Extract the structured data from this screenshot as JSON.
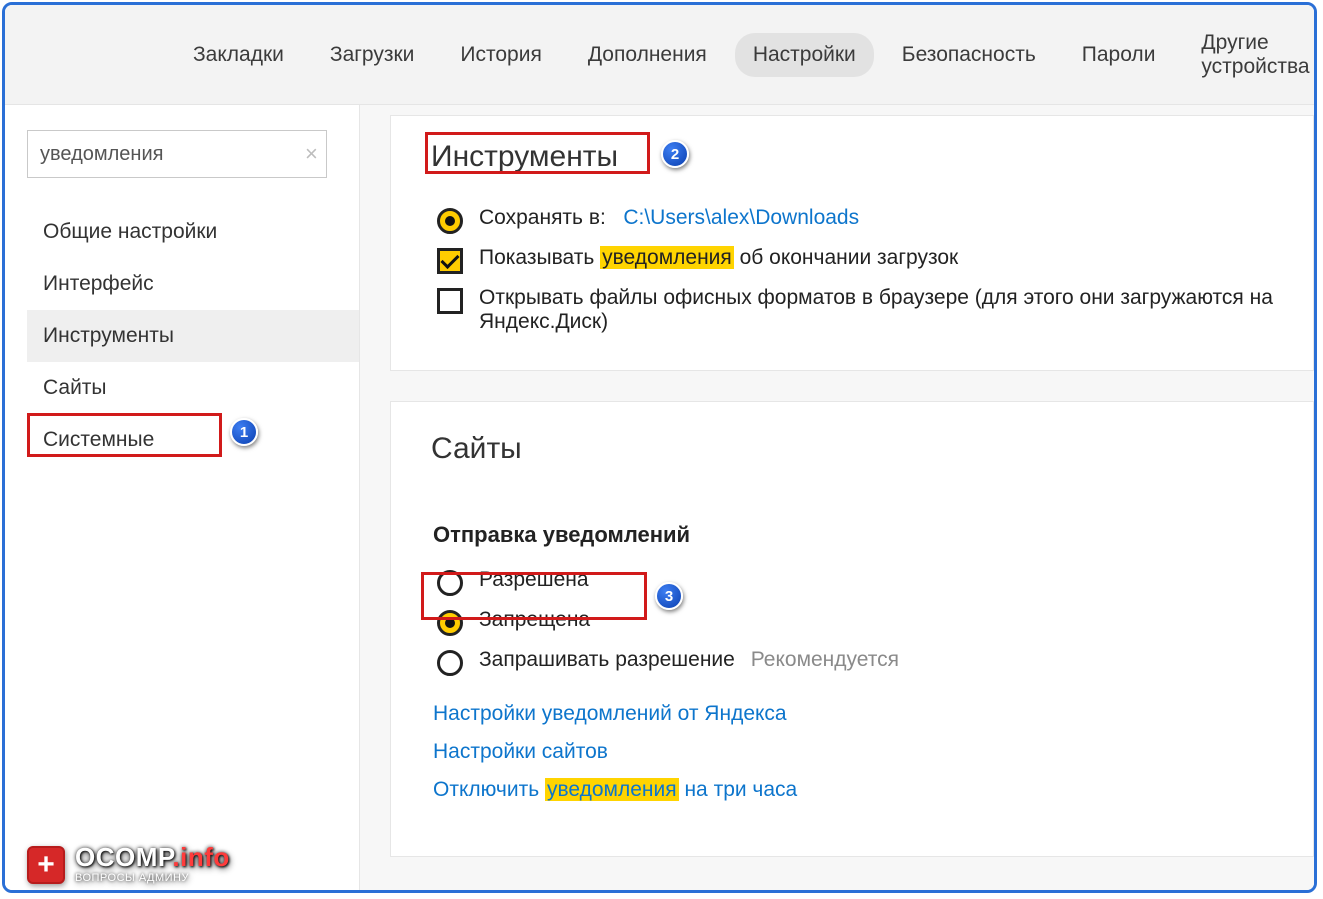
{
  "topbar": {
    "tabs": [
      "Закладки",
      "Загрузки",
      "История",
      "Дополнения",
      "Настройки",
      "Безопасность",
      "Пароли",
      "Другие устройства"
    ],
    "active_index": 4
  },
  "sidebar": {
    "search_value": "уведомления",
    "items": [
      "Общие настройки",
      "Интерфейс",
      "Инструменты",
      "Сайты",
      "Системные"
    ],
    "active_index": 2
  },
  "tools": {
    "heading": "Инструменты",
    "save_to_label": "Сохранять в:",
    "save_to_path": "C:\\Users\\alex\\Downloads",
    "notify_prefix": "Показывать ",
    "notify_hl": "уведомления",
    "notify_suffix": " об окончании загрузок",
    "open_office": "Открывать файлы офисных форматов в браузере (для этого они загружаются на Яндекс.Диск)"
  },
  "sites": {
    "heading": "Сайты",
    "subheading": "Отправка уведомлений",
    "opts": {
      "allowed": "Разрешена",
      "denied": "Запрещена",
      "ask": "Запрашивать разрешение",
      "ask_hint": "Рекомендуется"
    },
    "links": {
      "yandex": "Настройки уведомлений от Яндекса",
      "sites": "Настройки сайтов",
      "mute_prefix": "Отключить ",
      "mute_hl": "уведомления",
      "mute_suffix": " на три часа"
    }
  },
  "badges": {
    "b1": "1",
    "b2": "2",
    "b3": "3"
  },
  "logo": {
    "brand": "OCOMP",
    "tld": ".info",
    "tagline": "ВОПРОСЫ АДМИНУ"
  }
}
